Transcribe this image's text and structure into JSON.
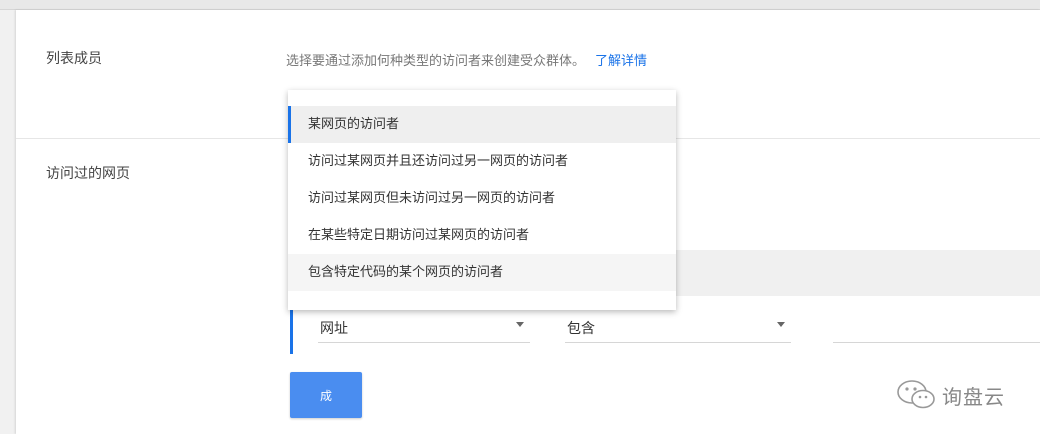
{
  "sections": {
    "list_members": {
      "label": "列表成员",
      "description": "选择要通过添加何种类型的访问者来创建受众群体。",
      "learn_more": "了解详情"
    },
    "visited_pages": {
      "label": "访问过的网页"
    }
  },
  "dropdown": {
    "items": [
      {
        "label": "某网页的访问者"
      },
      {
        "label": "访问过某网页并且还访问过另一网页的访问者"
      },
      {
        "label": "访问过某网页但未访问过另一网页的访问者"
      },
      {
        "label": "在某些特定日期访问过某网页的访问者"
      },
      {
        "label": "包含特定代码的某个网页的访问者"
      }
    ]
  },
  "rule": {
    "field_value": "网址",
    "operator_value": "包含",
    "value_text": ""
  },
  "action_button": {
    "label": "成"
  },
  "watermark": {
    "text": "询盘云",
    "icon": "wechat-icon"
  },
  "colors": {
    "accent": "#1a73e8",
    "button": "#4a8df0"
  }
}
